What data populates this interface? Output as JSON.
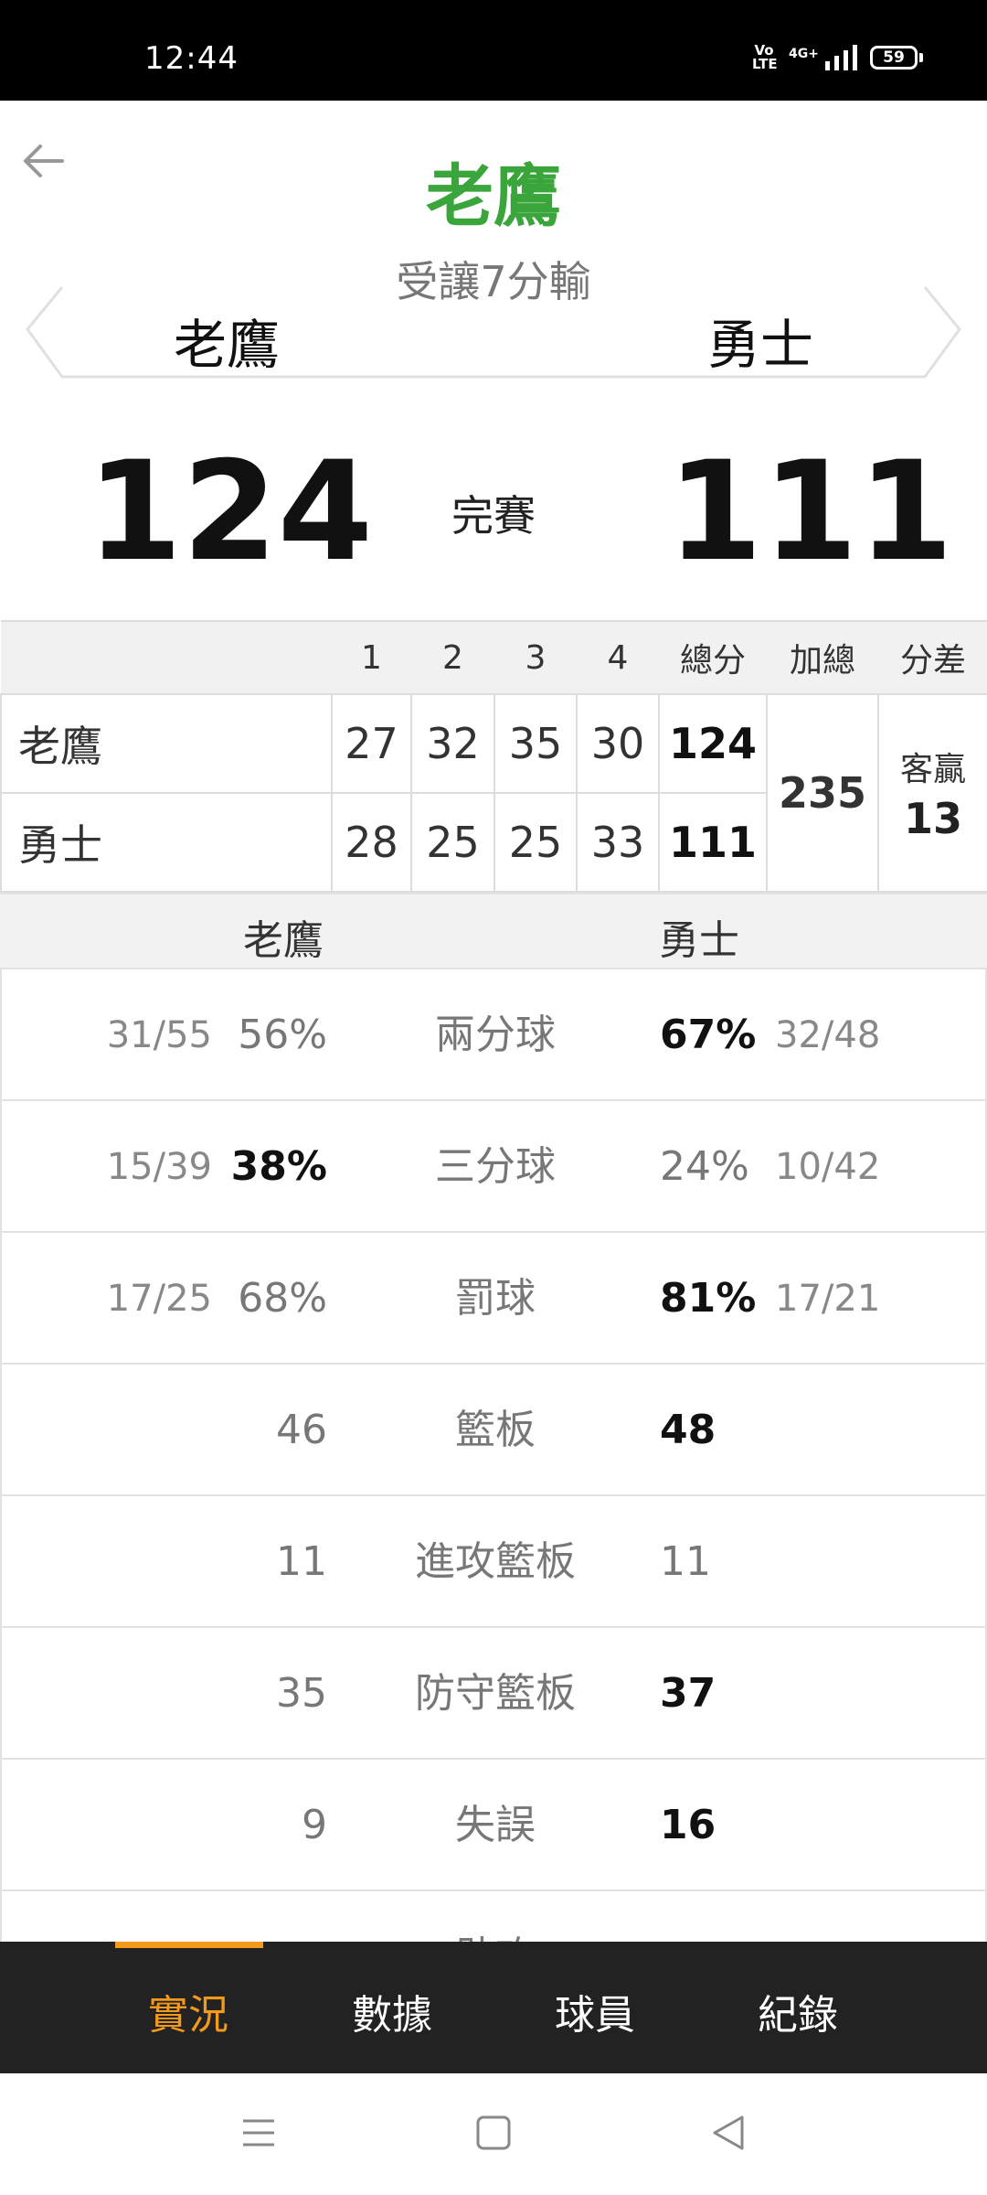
{
  "status_bar": {
    "time": "12:44",
    "volte": "Vo LTE",
    "network": "4G+",
    "battery": "59"
  },
  "header": {
    "winner": "老鷹",
    "spread_result": "受讓7分輸",
    "home_team": "老鷹",
    "away_team": "勇士",
    "home_score": "124",
    "away_score": "111",
    "game_status": "完賽"
  },
  "quarter_table": {
    "headers": [
      "1",
      "2",
      "3",
      "4",
      "總分",
      "加總",
      "分差"
    ],
    "rows": [
      {
        "team": "老鷹",
        "q": [
          "27",
          "32",
          "35",
          "30"
        ],
        "total": "124"
      },
      {
        "team": "勇士",
        "q": [
          "28",
          "25",
          "25",
          "33"
        ],
        "total": "111"
      }
    ],
    "combined_total": "235",
    "diff_label": "客贏",
    "diff_value": "13"
  },
  "stats": {
    "left_team": "老鷹",
    "right_team": "勇士",
    "rows": [
      {
        "label": "兩分球",
        "left_frac": "31/55",
        "left_val": "56%",
        "right_val": "67%",
        "right_frac": "32/48",
        "leader": "right"
      },
      {
        "label": "三分球",
        "left_frac": "15/39",
        "left_val": "38%",
        "right_val": "24%",
        "right_frac": "10/42",
        "leader": "left"
      },
      {
        "label": "罰球",
        "left_frac": "17/25",
        "left_val": "68%",
        "right_val": "81%",
        "right_frac": "17/21",
        "leader": "right"
      },
      {
        "label": "籃板",
        "left_frac": "",
        "left_val": "46",
        "right_val": "48",
        "right_frac": "",
        "leader": "right"
      },
      {
        "label": "進攻籃板",
        "left_frac": "",
        "left_val": "11",
        "right_val": "11",
        "right_frac": "",
        "leader": "none"
      },
      {
        "label": "防守籃板",
        "left_frac": "",
        "left_val": "35",
        "right_val": "37",
        "right_frac": "",
        "leader": "right"
      },
      {
        "label": "失誤",
        "left_frac": "",
        "left_val": "9",
        "right_val": "16",
        "right_frac": "",
        "leader": "right"
      },
      {
        "label": "助攻",
        "left_frac": "",
        "left_val": "",
        "right_val": "",
        "right_frac": "",
        "leader": "none"
      }
    ]
  },
  "bottom_nav": {
    "items": [
      "實況",
      "數據",
      "球員",
      "紀錄"
    ],
    "active": 0,
    "accent": "#f39a1d"
  },
  "colors": {
    "winner": "#3aa53a",
    "nav_bg": "#222222"
  }
}
